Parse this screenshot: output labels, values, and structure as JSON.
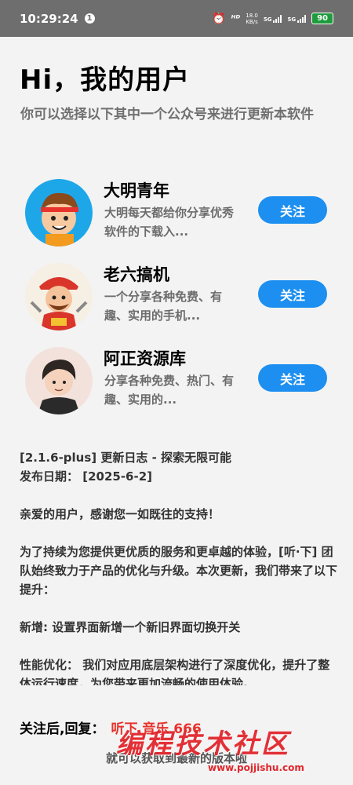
{
  "status_bar": {
    "time": "10:29:24",
    "notif_badge": "1",
    "hd_label": "???",
    "speed_value": "18.0",
    "speed_unit": "KB/s",
    "network1": "5G",
    "network2": "5G",
    "battery": "90",
    "battery_color": "#1e9b3c"
  },
  "header": {
    "title": "Hi，我的用户",
    "subtitle": "你可以选择以下其中一个公众号来进行更新本软件"
  },
  "accounts": [
    {
      "name": "大明青年",
      "desc": "大明每天都给你分享优秀软件的下载入...",
      "button": "关注",
      "avatar_icon": "cartoon-boy-avatar"
    },
    {
      "name": "老六搞机",
      "desc": "一个分享各种免费、有趣、实用的手机...",
      "button": "关注",
      "avatar_icon": "mechanic-avatar"
    },
    {
      "name": "阿正资源库",
      "desc": "分享各种免费、热门、有趣、实用的...",
      "button": "关注",
      "avatar_icon": "young-man-avatar"
    }
  ],
  "changelog": {
    "version_line": "[2.1.6-plus] 更新日志 - 探索无限可能",
    "date_line": "发布日期： [2025-6-2]",
    "greeting": "亲爱的用户，感谢您一如既往的支持！",
    "intro": "为了持续为您提供更优质的服务和更卓越的体验，[听·下] 团队始终致力于产品的优化与升级。本次更新，我们带来了以下提升：",
    "new_feature": "新增: 设置界面新增一个新旧界面切换开关",
    "perf": "性能优化： 我们对应用底层架构进行了深度优化，提升了整体运行速度，为您带来更加流畅的使用体验。"
  },
  "footer": {
    "label": "关注后,回复：",
    "keyword": "听下 音乐 666",
    "sub": "就可以获取到最新的版本啦"
  },
  "watermark": {
    "text": "编程技术社区",
    "url": "www.pojjishu.com"
  },
  "colors": {
    "accent": "#1d8ff0",
    "keyword": "#e8322c"
  }
}
